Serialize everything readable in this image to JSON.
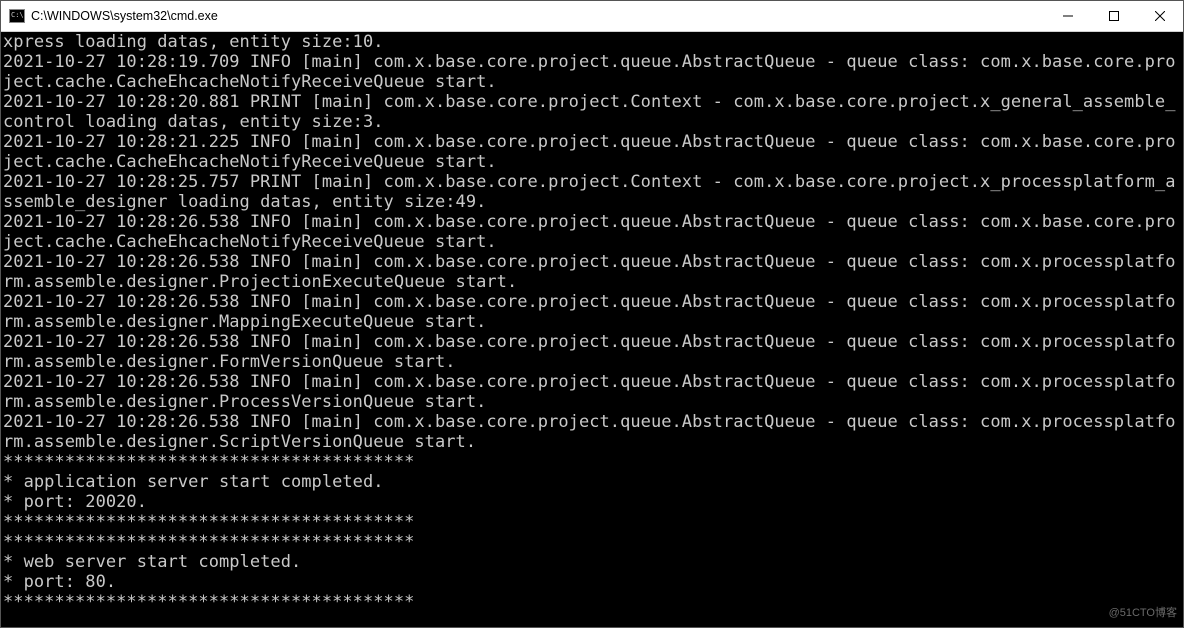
{
  "window": {
    "title": "C:\\WINDOWS\\system32\\cmd.exe"
  },
  "terminal": {
    "lines": [
      "xpress loading datas, entity size:10.",
      "2021-10-27 10:28:19.709 INFO [main] com.x.base.core.project.queue.AbstractQueue - queue class: com.x.base.core.project.cache.CacheEhcacheNotifyReceiveQueue start.",
      "2021-10-27 10:28:20.881 PRINT [main] com.x.base.core.project.Context - com.x.base.core.project.x_general_assemble_control loading datas, entity size:3.",
      "2021-10-27 10:28:21.225 INFO [main] com.x.base.core.project.queue.AbstractQueue - queue class: com.x.base.core.project.cache.CacheEhcacheNotifyReceiveQueue start.",
      "2021-10-27 10:28:25.757 PRINT [main] com.x.base.core.project.Context - com.x.base.core.project.x_processplatform_assemble_designer loading datas, entity size:49.",
      "2021-10-27 10:28:26.538 INFO [main] com.x.base.core.project.queue.AbstractQueue - queue class: com.x.base.core.project.cache.CacheEhcacheNotifyReceiveQueue start.",
      "2021-10-27 10:28:26.538 INFO [main] com.x.base.core.project.queue.AbstractQueue - queue class: com.x.processplatform.assemble.designer.ProjectionExecuteQueue start.",
      "2021-10-27 10:28:26.538 INFO [main] com.x.base.core.project.queue.AbstractQueue - queue class: com.x.processplatform.assemble.designer.MappingExecuteQueue start.",
      "2021-10-27 10:28:26.538 INFO [main] com.x.base.core.project.queue.AbstractQueue - queue class: com.x.processplatform.assemble.designer.FormVersionQueue start.",
      "2021-10-27 10:28:26.538 INFO [main] com.x.base.core.project.queue.AbstractQueue - queue class: com.x.processplatform.assemble.designer.ProcessVersionQueue start.",
      "2021-10-27 10:28:26.538 INFO [main] com.x.base.core.project.queue.AbstractQueue - queue class: com.x.processplatform.assemble.designer.ScriptVersionQueue start.",
      "****************************************",
      "* application server start completed.",
      "* port: 20020.",
      "****************************************",
      "****************************************",
      "* web server start completed.",
      "* port: 80.",
      "****************************************"
    ]
  },
  "watermark": "@51CTO博客"
}
